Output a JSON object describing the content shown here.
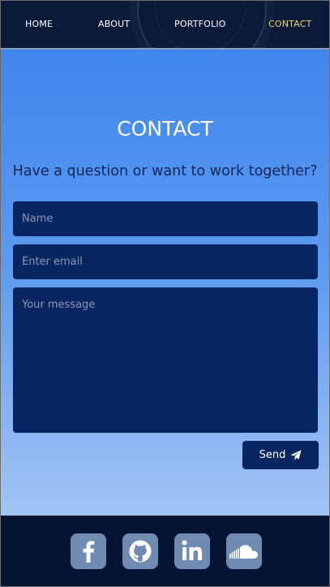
{
  "nav": {
    "items": [
      {
        "label": "HOME",
        "active": false
      },
      {
        "label": "ABOUT",
        "active": false
      },
      {
        "label": "PORTFOLIO",
        "active": false
      },
      {
        "label": "CONTACT",
        "active": true
      }
    ],
    "active_color": "#f2d35e"
  },
  "contact": {
    "title": "CONTACT",
    "subtitle": "Have a question or want to work together?",
    "name_placeholder": "Name",
    "email_placeholder": "Enter email",
    "message_placeholder": "Your message",
    "send_label": "Send"
  },
  "footer": {
    "social": [
      {
        "name": "facebook-icon"
      },
      {
        "name": "github-icon"
      },
      {
        "name": "linkedin-icon"
      },
      {
        "name": "soundcloud-icon"
      }
    ]
  },
  "colors": {
    "nav_bg": "#0b1a38",
    "field_bg": "#062561",
    "footer_bg": "#061433",
    "social_bg": "#6f8bb2"
  }
}
